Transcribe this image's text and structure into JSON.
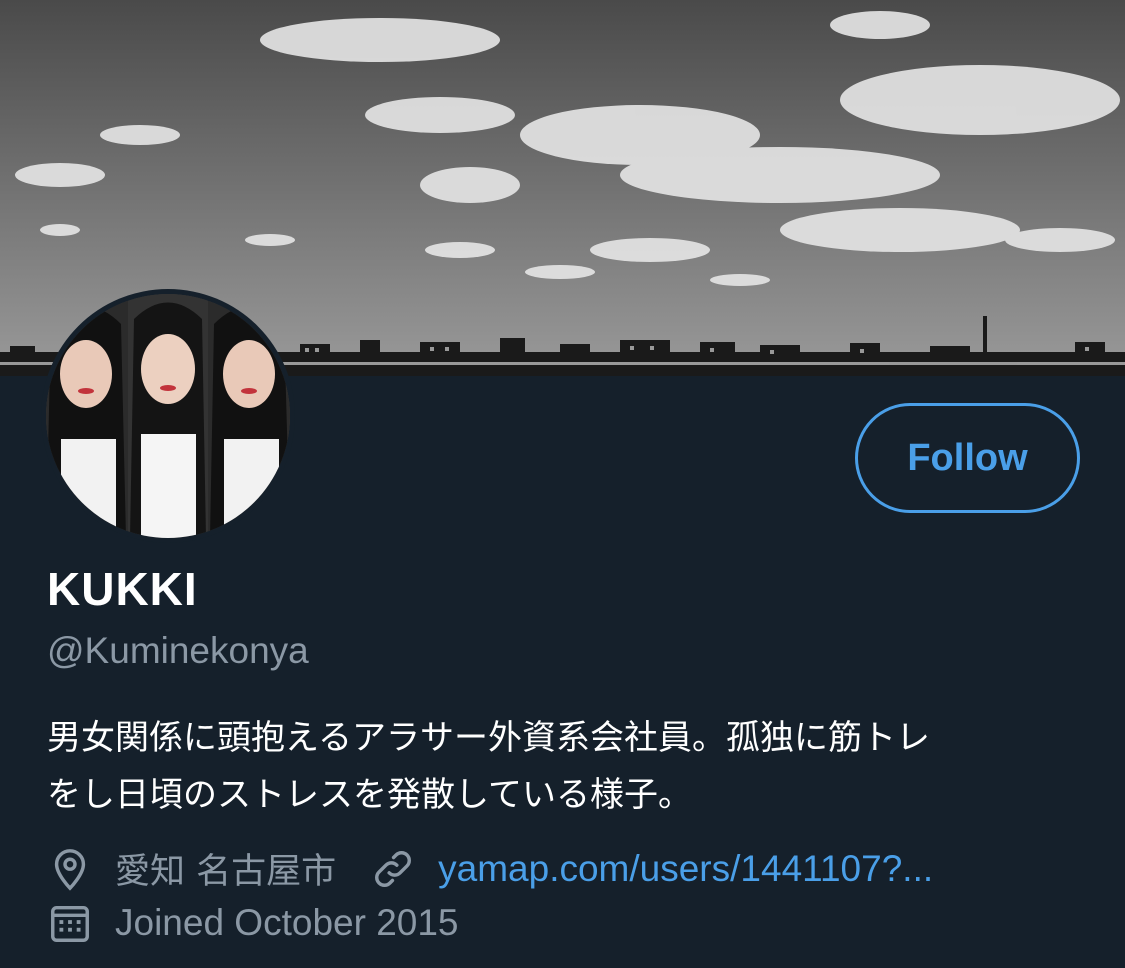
{
  "profile": {
    "display_name": "KUKKI",
    "handle": "@Kuminekonya",
    "bio_line1": "男女関係に頭抱えるアラサー外資系会社員。孤独に筋トレ",
    "bio_line2": "をし日頃のストレスを発散している様子。",
    "location": "愛知 名古屋市",
    "website": "yamap.com/users/1441107?...",
    "joined": "Joined October 2015"
  },
  "actions": {
    "follow_label": "Follow"
  },
  "icons": {
    "location": "location-pin-icon",
    "link": "link-icon",
    "calendar": "calendar-icon"
  },
  "colors": {
    "background": "#15202b",
    "accent": "#4a9fe8",
    "secondary_text": "#8b98a5"
  }
}
